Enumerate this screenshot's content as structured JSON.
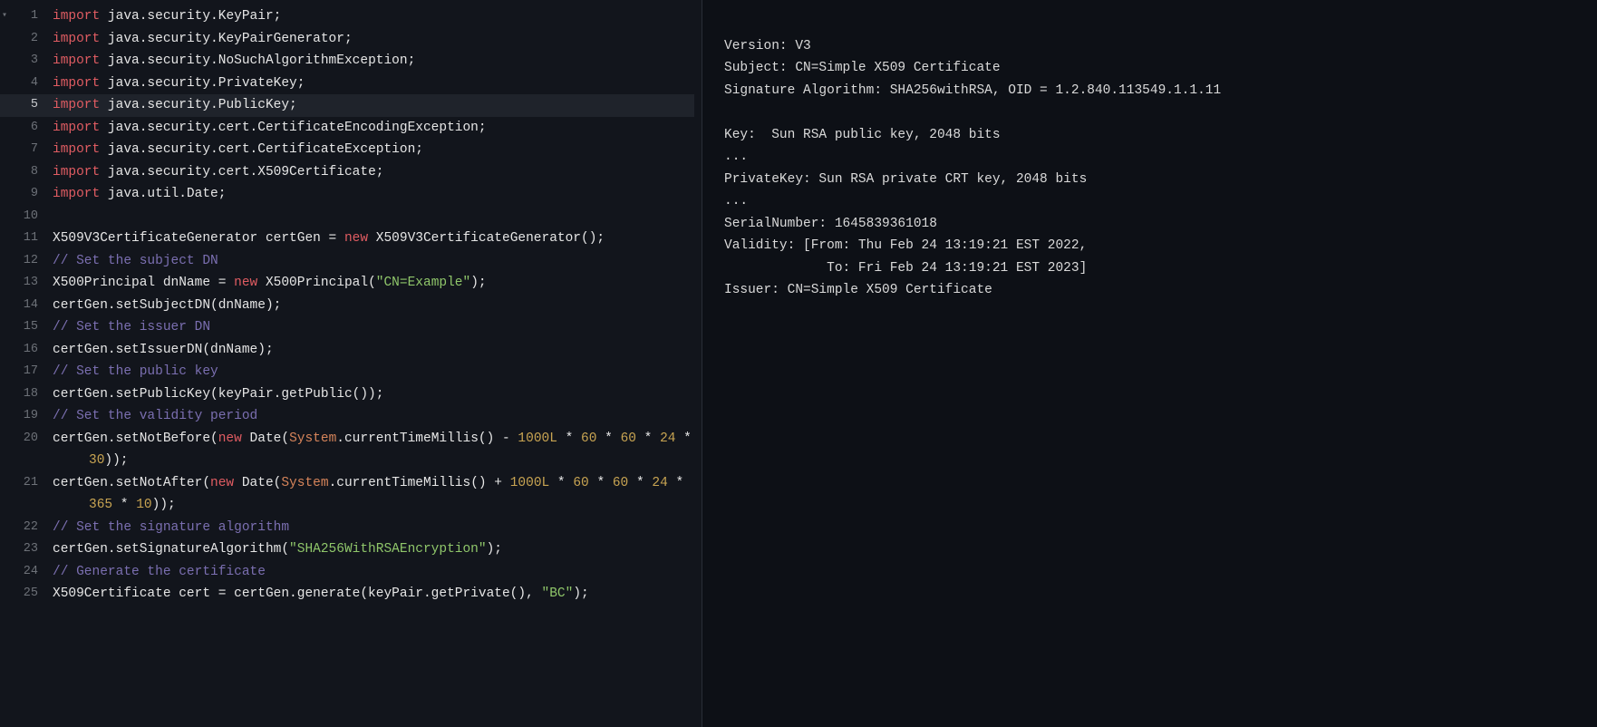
{
  "editor": {
    "current_line": 5,
    "lines": [
      {
        "n": 1,
        "fold": true,
        "tokens": [
          [
            "k",
            "import"
          ],
          [
            "id",
            " java.security.KeyPair;"
          ]
        ]
      },
      {
        "n": 2,
        "tokens": [
          [
            "k",
            "import"
          ],
          [
            "id",
            " java.security.KeyPairGenerator;"
          ]
        ]
      },
      {
        "n": 3,
        "tokens": [
          [
            "k",
            "import"
          ],
          [
            "id",
            " java.security.NoSuchAlgorithmException;"
          ]
        ]
      },
      {
        "n": 4,
        "tokens": [
          [
            "k",
            "import"
          ],
          [
            "id",
            " java.security.PrivateKey;"
          ]
        ]
      },
      {
        "n": 5,
        "tokens": [
          [
            "k",
            "import"
          ],
          [
            "id",
            " java.security.PublicKey;"
          ]
        ]
      },
      {
        "n": 6,
        "tokens": [
          [
            "k",
            "import"
          ],
          [
            "id",
            " java.security.cert.CertificateEncodingException;"
          ]
        ]
      },
      {
        "n": 7,
        "tokens": [
          [
            "k",
            "import"
          ],
          [
            "id",
            " java.security.cert.CertificateException;"
          ]
        ]
      },
      {
        "n": 8,
        "tokens": [
          [
            "k",
            "import"
          ],
          [
            "id",
            " java.security.cert.X509Certificate;"
          ]
        ]
      },
      {
        "n": 9,
        "tokens": [
          [
            "k",
            "import"
          ],
          [
            "id",
            " java.util.Date;"
          ]
        ]
      },
      {
        "n": 10,
        "tokens": [
          [
            "id",
            ""
          ]
        ]
      },
      {
        "n": 11,
        "tokens": [
          [
            "id",
            "X509V3CertificateGenerator certGen = "
          ],
          [
            "kn",
            "new"
          ],
          [
            "id",
            " X509V3CertificateGenerator();"
          ]
        ]
      },
      {
        "n": 12,
        "tokens": [
          [
            "cm",
            "// Set the subject DN"
          ]
        ]
      },
      {
        "n": 13,
        "tokens": [
          [
            "id",
            "X500Principal dnName = "
          ],
          [
            "kn",
            "new"
          ],
          [
            "id",
            " X500Principal("
          ],
          [
            "str",
            "\"CN=Example\""
          ],
          [
            "id",
            ");"
          ]
        ]
      },
      {
        "n": 14,
        "tokens": [
          [
            "id",
            "certGen.setSubjectDN(dnName);"
          ]
        ]
      },
      {
        "n": 15,
        "tokens": [
          [
            "cm",
            "// Set the issuer DN"
          ]
        ]
      },
      {
        "n": 16,
        "tokens": [
          [
            "id",
            "certGen.setIssuerDN(dnName);"
          ]
        ]
      },
      {
        "n": 17,
        "tokens": [
          [
            "cm",
            "// Set the public key"
          ]
        ]
      },
      {
        "n": 18,
        "tokens": [
          [
            "id",
            "certGen.setPublicKey(keyPair.getPublic());"
          ]
        ]
      },
      {
        "n": 19,
        "tokens": [
          [
            "cm",
            "// Set the validity period"
          ]
        ]
      },
      {
        "n": 20,
        "tokens": [
          [
            "id",
            "certGen.setNotBefore("
          ],
          [
            "kn",
            "new"
          ],
          [
            "id",
            " Date("
          ],
          [
            "cls",
            "System"
          ],
          [
            "id",
            ".currentTimeMillis() - "
          ],
          [
            "num",
            "1000L"
          ],
          [
            "id",
            " * "
          ],
          [
            "num",
            "60"
          ],
          [
            "id",
            " * "
          ],
          [
            "num",
            "60"
          ],
          [
            "id",
            " * "
          ],
          [
            "num",
            "24"
          ],
          [
            "id",
            " * "
          ]
        ]
      },
      {
        "n": 20,
        "wrap": true,
        "tokens": [
          [
            "num",
            "30"
          ],
          [
            "id",
            "));"
          ]
        ]
      },
      {
        "n": 21,
        "tokens": [
          [
            "id",
            "certGen.setNotAfter("
          ],
          [
            "kn",
            "new"
          ],
          [
            "id",
            " Date("
          ],
          [
            "cls",
            "System"
          ],
          [
            "id",
            ".currentTimeMillis() + "
          ],
          [
            "num",
            "1000L"
          ],
          [
            "id",
            " * "
          ],
          [
            "num",
            "60"
          ],
          [
            "id",
            " * "
          ],
          [
            "num",
            "60"
          ],
          [
            "id",
            " * "
          ],
          [
            "num",
            "24"
          ],
          [
            "id",
            " * "
          ]
        ]
      },
      {
        "n": 21,
        "wrap": true,
        "tokens": [
          [
            "num",
            "365"
          ],
          [
            "id",
            " * "
          ],
          [
            "num",
            "10"
          ],
          [
            "id",
            "));"
          ]
        ]
      },
      {
        "n": 22,
        "tokens": [
          [
            "cm",
            "// Set the signature algorithm"
          ]
        ]
      },
      {
        "n": 23,
        "tokens": [
          [
            "id",
            "certGen.setSignatureAlgorithm("
          ],
          [
            "str",
            "\"SHA256WithRSAEncryption\""
          ],
          [
            "id",
            ");"
          ]
        ]
      },
      {
        "n": 24,
        "tokens": [
          [
            "cm",
            "// Generate the certificate"
          ]
        ]
      },
      {
        "n": 25,
        "tokens": [
          [
            "id",
            "X509Certificate cert = certGen.generate(keyPair.getPrivate(), "
          ],
          [
            "str",
            "\"BC\""
          ],
          [
            "id",
            ");"
          ]
        ]
      }
    ]
  },
  "output": {
    "lines": [
      "",
      "Version: V3",
      "Subject: CN=Simple X509 Certificate",
      "Signature Algorithm: SHA256withRSA, OID = 1.2.840.113549.1.1.11",
      "",
      "Key:  Sun RSA public key, 2048 bits",
      "...",
      "PrivateKey: Sun RSA private CRT key, 2048 bits",
      "...",
      "SerialNumber: 1645839361018",
      "Validity: [From: Thu Feb 24 13:19:21 EST 2022,",
      "             To: Fri Feb 24 13:19:21 EST 2023]",
      "Issuer: CN=Simple X509 Certificate"
    ]
  }
}
